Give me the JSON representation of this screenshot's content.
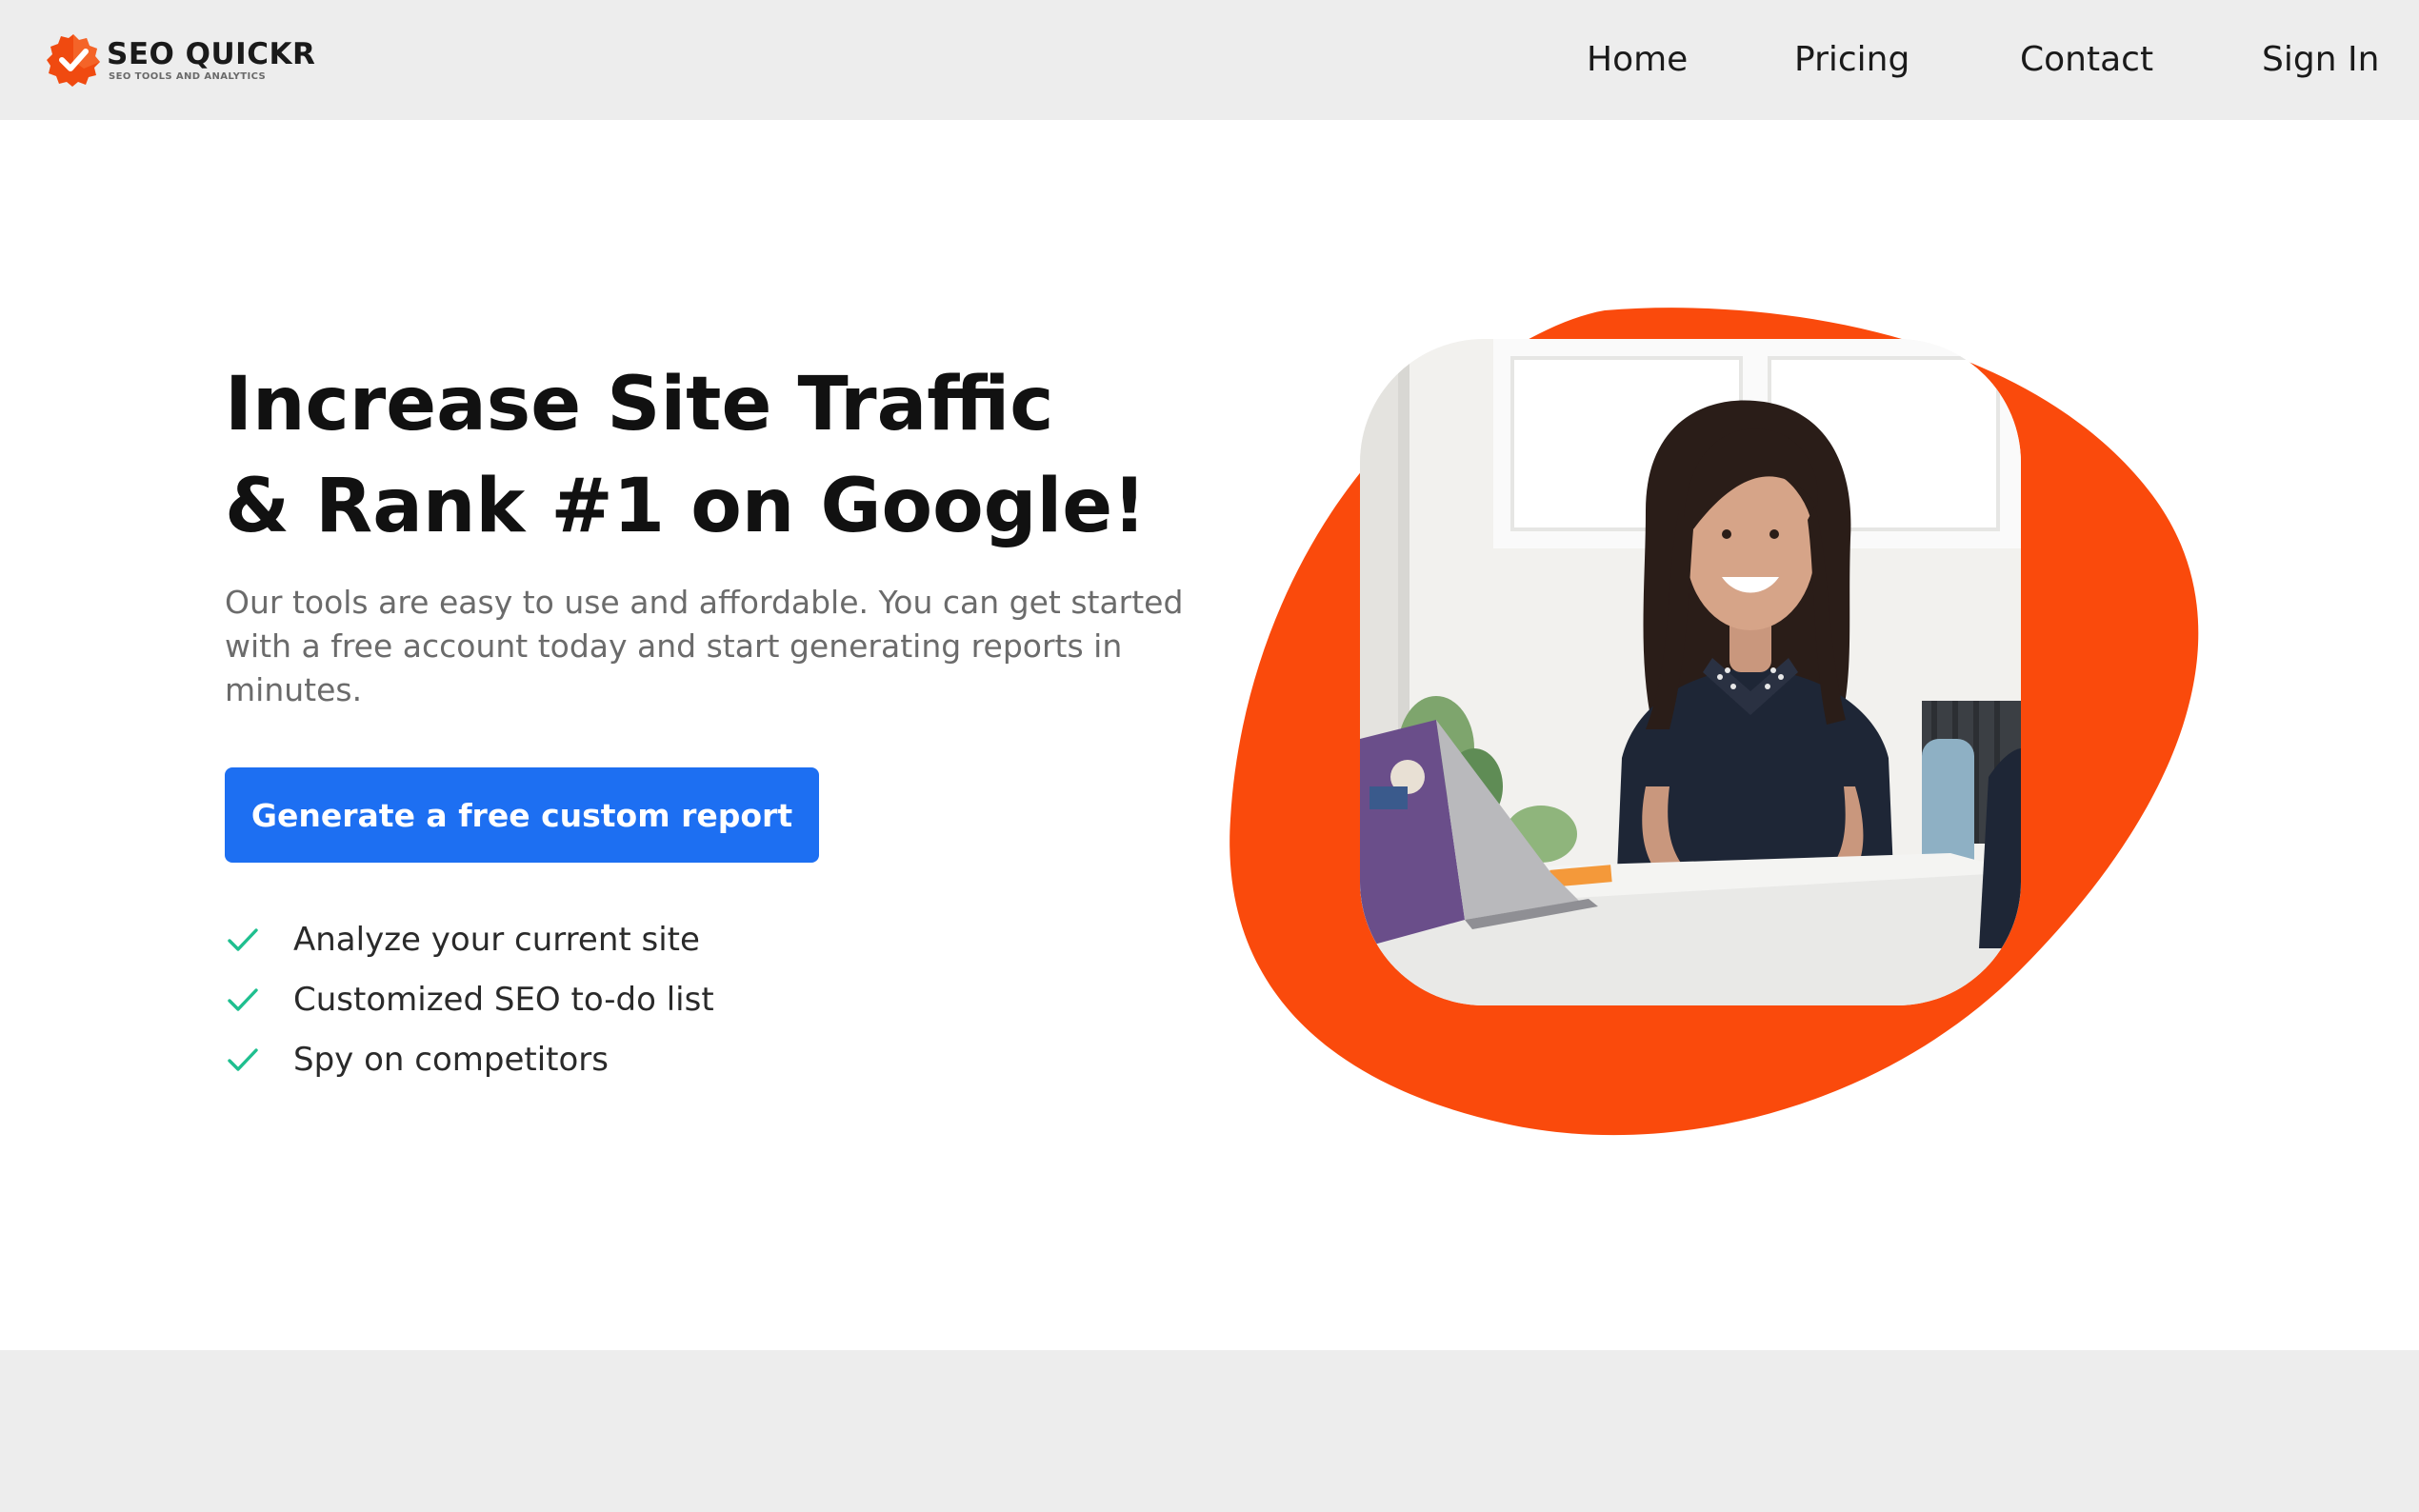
{
  "brand": {
    "name": "SEO QUICKR",
    "tagline": "SEO TOOLS AND ANALYTICS",
    "logo_icon": "badge-check-icon",
    "accent_color": "#f04a10"
  },
  "nav": {
    "items": [
      {
        "label": "Home"
      },
      {
        "label": "Pricing"
      },
      {
        "label": "Contact"
      },
      {
        "label": "Sign In"
      }
    ]
  },
  "hero": {
    "title_line1": "Increase Site Traffic",
    "title_line2": "& Rank #1 on Google!",
    "subtitle": "Our tools are easy to use and affordable. You can get started with a free account today and start generating reports in minutes.",
    "cta_label": "Generate a free custom report",
    "cta_color": "#1d6ff2",
    "features": [
      {
        "label": "Analyze your current site",
        "icon": "check-icon"
      },
      {
        "label": "Customized SEO to-do list",
        "icon": "check-icon"
      },
      {
        "label": "Spy on competitors",
        "icon": "check-icon"
      }
    ],
    "check_color": "#1fbf8f",
    "blob_color": "#fa4a0c",
    "image_subject": "smiling woman at a desk with a laptop"
  }
}
